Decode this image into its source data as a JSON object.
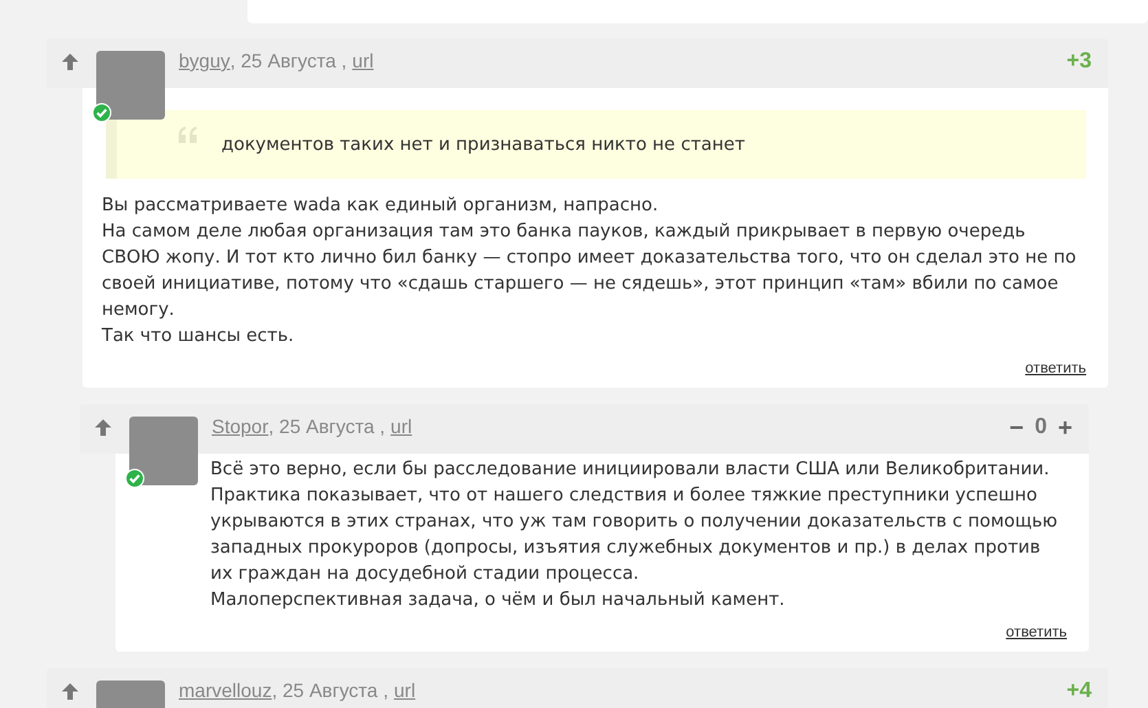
{
  "comments": [
    {
      "author": "byguy",
      "date": ", 25 Августа ,",
      "link": "url",
      "score": "+3",
      "kind": "positive",
      "online": true,
      "quote": "документов таких нет и признаваться никто не станет",
      "paragraphs": [
        "Вы рассматриваете wada как единый организм, напрасно.",
        "На самом деле любая организация там это банка пауков, каждый прикрывает в первую очередь СВОЮ жопу. И тот кто лично бил банку — стопро имеет доказательства того, что он сделал это не по своей инициативе, потому что «сдашь старшего — не сядешь», этот принцип «там» вбили по самое немогу.",
        "Так что шансы есть."
      ],
      "reply": "ответить",
      "children": [
        {
          "author": "Stopor",
          "date": ", 25 Августа ,",
          "link": "url",
          "score": "0",
          "kind": "neutral",
          "vote_down": "−",
          "vote_up": "+",
          "online": true,
          "paragraphs": [
            "Всё это верно, если бы расследование инициировали власти США или Великобритании. Практика показывает, что от нашего следствия и более тяжкие преступники успешно укрываются в этих странах, что уж там говорить о получении доказательств с помощью западных прокуроров (допросы, изъятия служебных документов и пр.) в делах против их граждан на досудебной стадии процесса.",
            "Малоперспективная задача, о чём и был начальный камент."
          ],
          "reply": "ответить"
        }
      ]
    },
    {
      "author": "marvellouz",
      "date": ", 25 Августа ,",
      "link": "url",
      "score": "+4",
      "kind": "positive"
    }
  ]
}
